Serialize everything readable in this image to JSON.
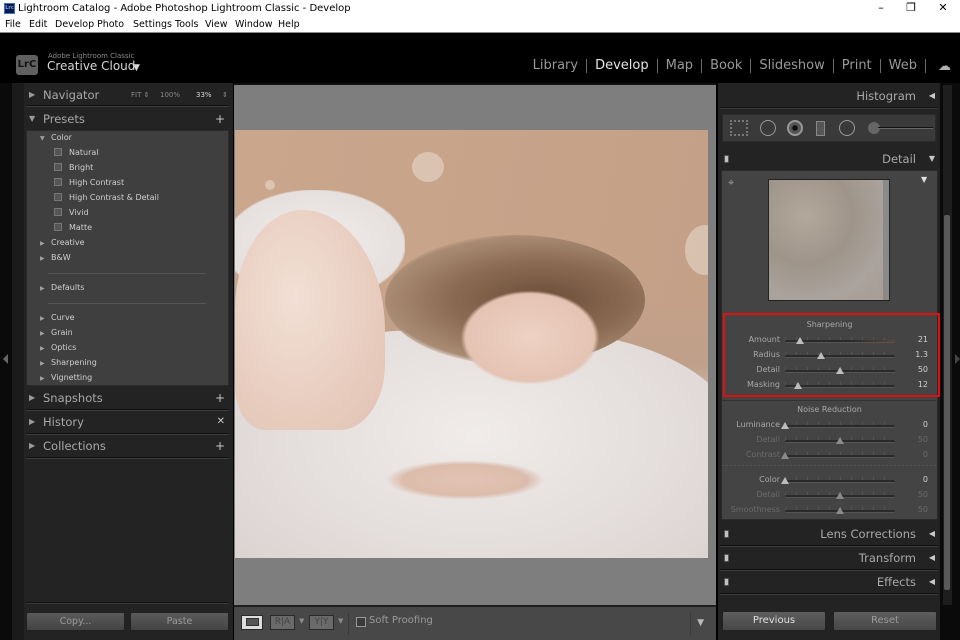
{
  "window": {
    "title": "Lightroom Catalog - Adobe Photoshop Lightroom Classic - Develop",
    "app_icon": "Lrc",
    "controls": [
      "minimize",
      "restore",
      "close"
    ]
  },
  "menubar": [
    "File",
    "Edit",
    "Develop",
    "Photo",
    "Settings",
    "Tools",
    "View",
    "Window",
    "Help"
  ],
  "identity": {
    "logo": "LrC",
    "subtitle": "Adobe Lightroom Classic",
    "title": "Creative Cloud",
    "caret": "▼"
  },
  "modules": [
    {
      "label": "Library",
      "active": false
    },
    {
      "label": "Develop",
      "active": true
    },
    {
      "label": "Map",
      "active": false
    },
    {
      "label": "Book",
      "active": false
    },
    {
      "label": "Slideshow",
      "active": false
    },
    {
      "label": "Print",
      "active": false
    },
    {
      "label": "Web",
      "active": false
    }
  ],
  "cloud_icon": "cloud-sync-icon",
  "left_panel": {
    "navigator": {
      "label": "Navigator",
      "fit": "FIT ⇕",
      "z100": "100%",
      "z33": "33%",
      "spin": "⇕"
    },
    "presets": {
      "label": "Presets",
      "add": "+",
      "items": [
        {
          "type": "group-open",
          "label": "Color"
        },
        {
          "type": "preset",
          "label": "Natural"
        },
        {
          "type": "preset",
          "label": "Bright"
        },
        {
          "type": "preset",
          "label": "High Contrast"
        },
        {
          "type": "preset",
          "label": "High Contrast & Detail"
        },
        {
          "type": "preset",
          "label": "Vivid"
        },
        {
          "type": "preset",
          "label": "Matte"
        },
        {
          "type": "group",
          "label": "Creative"
        },
        {
          "type": "group",
          "label": "B&W"
        },
        {
          "type": "group",
          "label": "Defaults"
        },
        {
          "type": "group",
          "label": "Curve"
        },
        {
          "type": "group",
          "label": "Grain"
        },
        {
          "type": "group",
          "label": "Optics"
        },
        {
          "type": "group",
          "label": "Sharpening"
        },
        {
          "type": "group",
          "label": "Vignetting"
        }
      ]
    },
    "snapshots": {
      "label": "Snapshots",
      "action": "+"
    },
    "history": {
      "label": "History",
      "action": "✕"
    },
    "collections": {
      "label": "Collections",
      "action": "+"
    },
    "copy_button": "Copy...",
    "paste_button": "Paste"
  },
  "toolbar": {
    "loupe_view": "loupe-view-icon",
    "before_after_ra": "R|A",
    "before_after_yy": "Y|Y",
    "soft_proofing_label": "Soft Proofing",
    "soft_proofing_checked": false,
    "menu_caret": "▼"
  },
  "right_panel": {
    "histogram": {
      "label": "Histogram",
      "tri": "◀"
    },
    "tools": [
      "crop-overlay-icon",
      "spot-removal-icon",
      "red-eye-icon",
      "graduated-filter-icon",
      "radial-filter-icon",
      "adjustment-brush-slider"
    ],
    "detail": {
      "label": "Detail",
      "tri": "▼",
      "sharpening": {
        "title": "Sharpening",
        "sliders": [
          {
            "label": "Amount",
            "value": "21",
            "fraction": 0.14
          },
          {
            "label": "Radius",
            "value": "1.3",
            "fraction": 0.33
          },
          {
            "label": "Detail",
            "value": "50",
            "fraction": 0.5
          },
          {
            "label": "Masking",
            "value": "12",
            "fraction": 0.12
          }
        ]
      },
      "noise_reduction": {
        "title": "Noise Reduction",
        "sliders": [
          {
            "label": "Luminance",
            "value": "0",
            "fraction": 0.0,
            "dim": false
          },
          {
            "label": "Detail",
            "value": "50",
            "fraction": 0.5,
            "dim": true
          },
          {
            "label": "Contrast",
            "value": "0",
            "fraction": 0.0,
            "dim": true
          },
          {
            "label": "Color",
            "value": "0",
            "fraction": 0.0,
            "dim": false
          },
          {
            "label": "Detail",
            "value": "50",
            "fraction": 0.5,
            "dim": true
          },
          {
            "label": "Smoothness",
            "value": "50",
            "fraction": 0.5,
            "dim": true
          }
        ]
      }
    },
    "lens_corrections": {
      "label": "Lens Corrections",
      "tri": "◀"
    },
    "transform": {
      "label": "Transform",
      "tri": "◀"
    },
    "effects": {
      "label": "Effects",
      "tri": "◀"
    },
    "previous_button": "Previous",
    "reset_button": "Reset"
  },
  "colors": {
    "highlight": "#e01010",
    "panel_bg": "#232323",
    "viewer_bg": "#7e7e7e"
  }
}
